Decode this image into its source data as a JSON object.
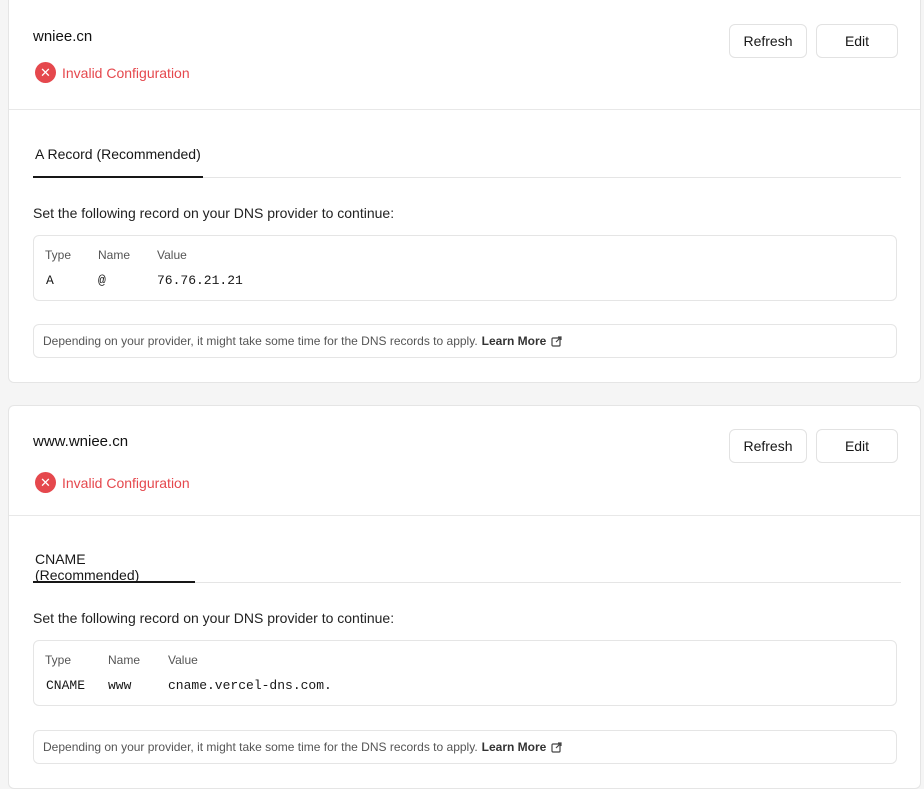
{
  "domains": [
    {
      "name": "wniee.cn",
      "status": "Invalid Configuration",
      "status_icon": "x-circle-icon",
      "buttons": {
        "refresh": "Refresh",
        "edit": "Edit"
      },
      "tab": "A Record (Recommended)",
      "instruction": "Set the following record on your DNS provider to continue:",
      "record_headers": {
        "type": "Type",
        "name": "Name",
        "value": "Value"
      },
      "record": {
        "type": "A",
        "name": "@",
        "value": "76.76.21.21"
      },
      "note": "Depending on your provider, it might take some time for the DNS records to apply.",
      "learn_more": "Learn More"
    },
    {
      "name": "www.wniee.cn",
      "status": "Invalid Configuration",
      "status_icon": "x-circle-icon",
      "buttons": {
        "refresh": "Refresh",
        "edit": "Edit"
      },
      "tab": "CNAME (Recommended)",
      "instruction": "Set the following record on your DNS provider to continue:",
      "record_headers": {
        "type": "Type",
        "name": "Name",
        "value": "Value"
      },
      "record": {
        "type": "CNAME",
        "name": "www",
        "value": "cname.vercel-dns.com."
      },
      "note": "Depending on your provider, it might take some time for the DNS records to apply.",
      "learn_more": "Learn More"
    }
  ],
  "colors": {
    "error": "#e5484d",
    "border": "#e5e5e5",
    "text": "#171717"
  }
}
